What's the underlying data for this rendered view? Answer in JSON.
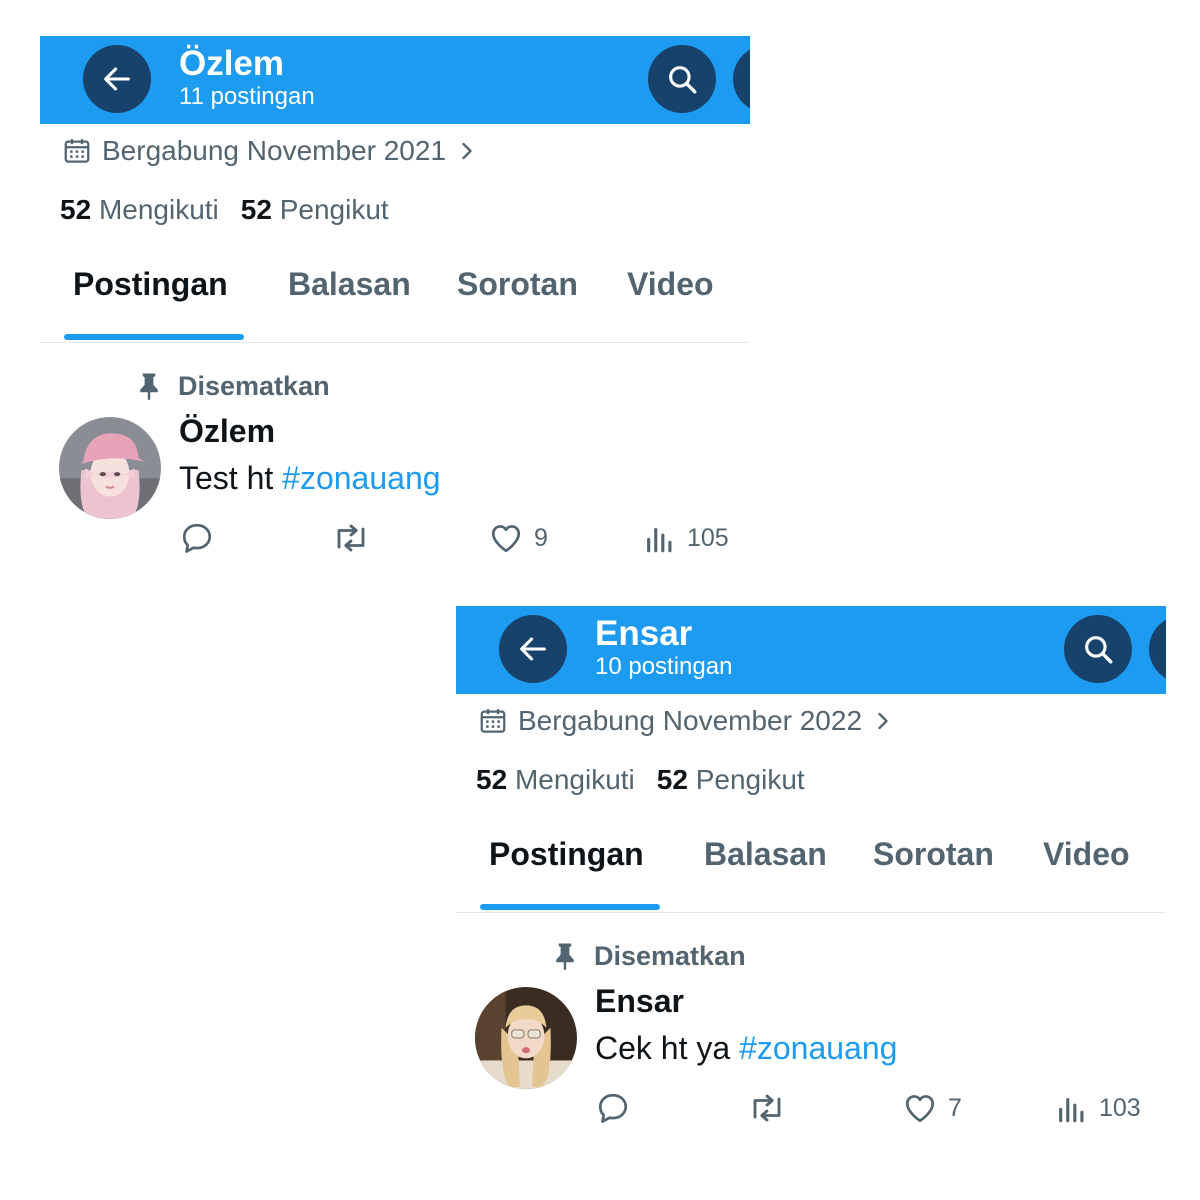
{
  "colors": {
    "accent": "#1d9bf0",
    "header_button_bg": "#17426b",
    "text_primary": "#0f1419",
    "text_secondary": "#536471"
  },
  "profiles": [
    {
      "header": {
        "name": "Özlem",
        "post_count": "11 postingan",
        "back_icon": "arrow-left-icon",
        "search_icon": "search-icon"
      },
      "joined": {
        "icon": "calendar-icon",
        "text": "Bergabung November 2021",
        "chevron_icon": "chevron-right-icon"
      },
      "following": {
        "count": "52",
        "label": "Mengikuti"
      },
      "followers": {
        "count": "52",
        "label": "Pengikut"
      },
      "tabs": [
        {
          "label": "Postingan"
        },
        {
          "label": "Balasan"
        },
        {
          "label": "Sorotan"
        },
        {
          "label": "Video"
        }
      ],
      "active_tab": "Postingan",
      "pinned": {
        "label": "Disematkan",
        "icon": "pin-icon",
        "author": "Özlem",
        "text": "Test ht",
        "hashtag": "#zonauang",
        "avatar": "avatar-pink-cap",
        "likes": "9",
        "views": "105"
      }
    },
    {
      "header": {
        "name": "Ensar",
        "post_count": "10 postingan",
        "back_icon": "arrow-left-icon",
        "search_icon": "search-icon"
      },
      "joined": {
        "icon": "calendar-icon",
        "text": "Bergabung November 2022",
        "chevron_icon": "chevron-right-icon"
      },
      "following": {
        "count": "52",
        "label": "Mengikuti"
      },
      "followers": {
        "count": "52",
        "label": "Pengikut"
      },
      "tabs": [
        {
          "label": "Postingan"
        },
        {
          "label": "Balasan"
        },
        {
          "label": "Sorotan"
        },
        {
          "label": "Video"
        }
      ],
      "active_tab": "Postingan",
      "pinned": {
        "label": "Disematkan",
        "icon": "pin-icon",
        "author": "Ensar",
        "text": "Cek ht ya",
        "hashtag": "#zonauang",
        "avatar": "avatar-blonde-sunglasses",
        "likes": "7",
        "views": "103"
      }
    }
  ]
}
